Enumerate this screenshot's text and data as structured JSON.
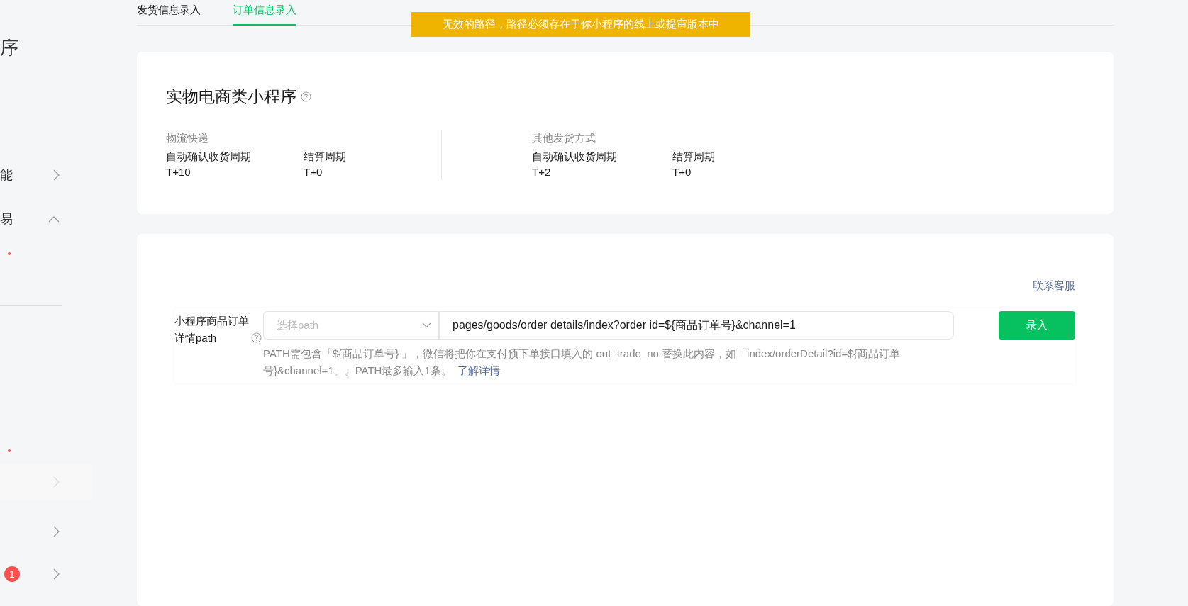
{
  "sidebar": {
    "title": "序",
    "items": [
      {
        "kind": "nav",
        "label": "能",
        "expanded": false
      },
      {
        "kind": "nav",
        "label": "易",
        "expanded": true
      },
      {
        "kind": "dot"
      },
      {
        "kind": "divider"
      },
      {
        "kind": "dot"
      },
      {
        "kind": "nav",
        "expanded": false,
        "disabled": true
      },
      {
        "kind": "nav",
        "expanded": false
      },
      {
        "kind": "nav",
        "expanded": false,
        "badge": "1"
      }
    ]
  },
  "tabs": [
    {
      "label": "发货信息录入",
      "selected": false
    },
    {
      "label": "订单信息录入",
      "selected": true
    }
  ],
  "toast": {
    "text": "无效的路径，路径必须存在于你小程序的线上或提审版本中"
  },
  "summary_card": {
    "title": "实物电商类小程序",
    "sections": [
      {
        "heading": "物流快递",
        "fields": [
          {
            "label": "自动确认收货周期",
            "value": "T+10"
          },
          {
            "label": "结算周期",
            "value": "T+0"
          }
        ]
      },
      {
        "heading": "其他发货方式",
        "fields": [
          {
            "label": "自动确认收货周期",
            "value": "T+2"
          },
          {
            "label": "结算周期",
            "value": "T+0"
          }
        ]
      }
    ]
  },
  "path_form": {
    "contact_link": "联系客服",
    "label": "小程序商品订单详情path",
    "select_placeholder": "选择path",
    "input_value": "pages/goods/order details/index?order id=${商品订单号}&channel=1",
    "submit": "录入",
    "hint": "PATH需包含「${商品订单号} 」，微信将把你在支付预下单接口填入的 out_trade_no 替换此内容，如「index/orderDetail?id=${商品订单号}&channel=1」。PATH最多输入1条。",
    "hint_link": "了解详情"
  }
}
